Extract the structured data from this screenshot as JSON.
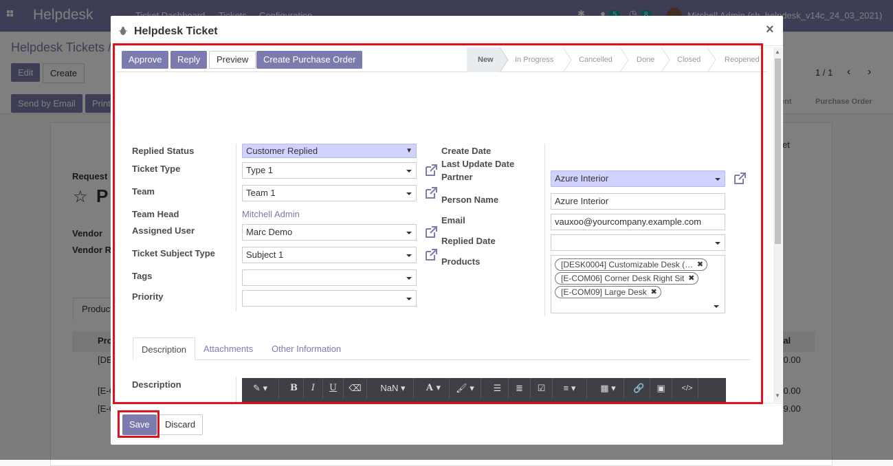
{
  "app": {
    "brand": "Helpdesk",
    "menu": [
      "Ticket Dashboard",
      "Tickets",
      "Configuration"
    ],
    "badge_messages": "5",
    "badge_activities": "8",
    "user": "Mitchell Admin (sh_helpdesk_v14c_24_03_2021)"
  },
  "background": {
    "breadcrumb": "Helpdesk Tickets /",
    "edit_label": "Edit",
    "create_label": "Create",
    "send_email_label": "Send by Email",
    "print_label": "Print",
    "pager": "1 / 1",
    "stage_right_1": "ent",
    "stage_right_2": "Purchase Order",
    "request_label": "Request",
    "title_partial": "P",
    "vendor_label": "Vendor",
    "vendor_ref_label": "Vendor R",
    "products_tab": "Product",
    "col_pro": "Pro",
    "col_total": "tal",
    "smart_right": "et",
    "rows": [
      {
        "c1": "[DE",
        "c2": "500.00"
      },
      {
        "c1": "[E-C",
        "c2": "500.00"
      },
      {
        "c1": "[E-C",
        "c2": "299.00"
      }
    ]
  },
  "modal": {
    "title": "Helpdesk Ticket",
    "close": "×",
    "buttons": {
      "approve": "Approve",
      "reply": "Reply",
      "preview": "Preview",
      "create_po": "Create Purchase Order"
    },
    "stages": [
      "New",
      "In Progress",
      "Cancelled",
      "Done",
      "Closed",
      "Reopened"
    ],
    "active_stage": "New",
    "left_labels": {
      "replied_status": "Replied Status",
      "ticket_type": "Ticket Type",
      "team": "Team",
      "team_head": "Team Head",
      "assigned_user": "Assigned User",
      "ticket_subject_type": "Ticket Subject Type",
      "tags": "Tags",
      "priority": "Priority"
    },
    "left_values": {
      "replied_status": "Customer Replied",
      "ticket_type": "Type 1",
      "team": "Team 1",
      "team_head": "Mitchell Admin",
      "assigned_user": "Marc Demo",
      "ticket_subject_type": "Subject 1",
      "tags": "",
      "priority": ""
    },
    "right_labels": {
      "create_date": "Create Date",
      "last_update_date": "Last Update Date",
      "partner": "Partner",
      "person_name": "Person Name",
      "email": "Email",
      "replied_date": "Replied Date",
      "products": "Products"
    },
    "right_values": {
      "partner": "Azure Interior",
      "person_name": "Azure Interior",
      "email": "vauxoo@yourcompany.example.com",
      "replied_date": ""
    },
    "products": [
      "[DESK0004] Customizable Desk (…",
      "[E-COM06] Corner Desk Right Sit",
      "[E-COM09] Large Desk"
    ],
    "tabs": [
      "Description",
      "Attachments",
      "Other Information"
    ],
    "active_tab": "Description",
    "description_label": "Description",
    "editor": {
      "bold": "B",
      "italic": "I",
      "underline": "U",
      "font_size": "NaN",
      "font_color": "A"
    },
    "footer": {
      "save": "Save",
      "discard": "Discard"
    }
  },
  "colors": {
    "brand": "#7c7bad",
    "required_field": "#d2d2ff",
    "highlight": "#e0101a",
    "editor_bg": "#3f4045"
  }
}
